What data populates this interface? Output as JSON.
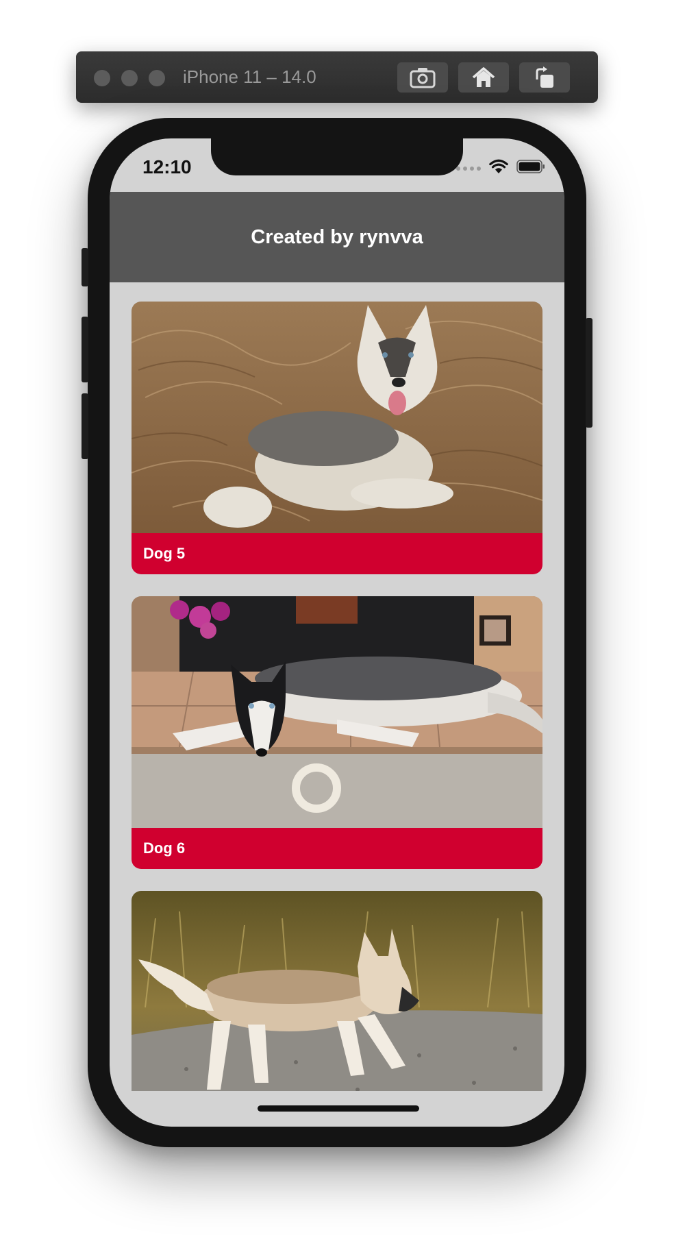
{
  "simulator": {
    "title": "iPhone 11 – 14.0",
    "buttons": [
      {
        "name": "screenshot-icon"
      },
      {
        "name": "home-icon"
      },
      {
        "name": "rotate-icon"
      }
    ]
  },
  "status_bar": {
    "time": "12:10"
  },
  "nav": {
    "title": "Created by rynvva"
  },
  "cards": [
    {
      "caption": "Dog 5",
      "photo": "husky lying in dry grass"
    },
    {
      "caption": "Dog 6",
      "photo": "husky lying on floor by fireplace with toy ring"
    },
    {
      "caption": "",
      "photo": "husky walking on gravel path"
    }
  ],
  "colors": {
    "nav_background": "#565656",
    "caption_background": "#d0002f",
    "screen_background": "#d3d3d3"
  }
}
